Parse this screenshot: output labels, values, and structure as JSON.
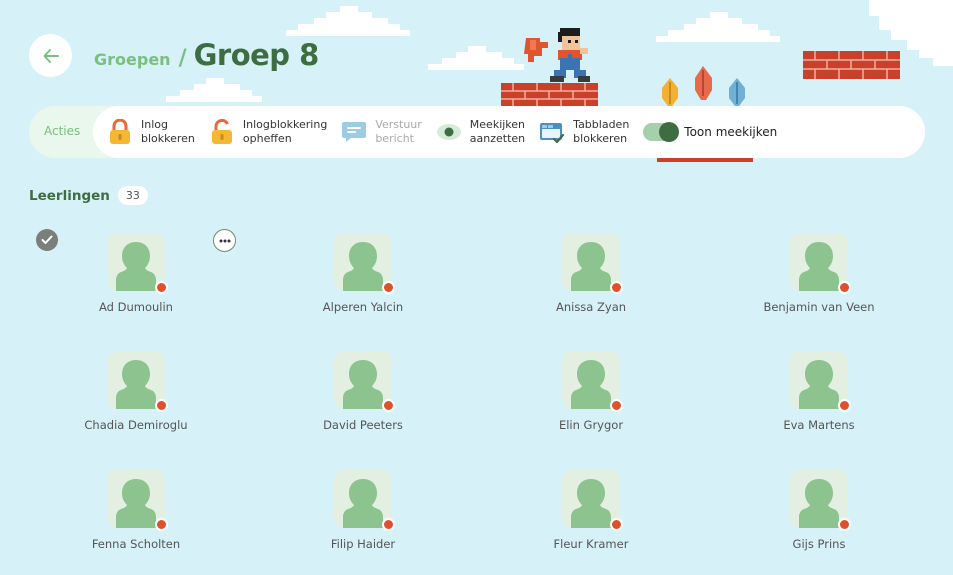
{
  "header": {
    "back_icon": "arrow-left-icon",
    "breadcrumb_parent": "Groepen",
    "breadcrumb_separator": "/",
    "title": "Groep 8"
  },
  "actions": {
    "label": "Acties",
    "items": [
      {
        "label": "Inlog\nblokkeren",
        "icon": "lock-icon",
        "disabled": false
      },
      {
        "label": "Inlogblokkering\nopheffen",
        "icon": "unlock-icon",
        "disabled": false
      },
      {
        "label": "Verstuur\nbericht",
        "icon": "message-icon",
        "disabled": true
      },
      {
        "label": "Meekijken\naanzetten",
        "icon": "eye-icon",
        "disabled": false
      },
      {
        "label": "Tabbladen\nblokkeren",
        "icon": "tabs-block-icon",
        "disabled": false
      }
    ],
    "toggle_label": "Toon meekijken",
    "toggle_on": true
  },
  "students_section": {
    "title": "Leerlingen",
    "count": "33"
  },
  "students": [
    "Ad Dumoulin",
    "Alperen Yalcin",
    "Anissa Zyan",
    "Benjamin van Veen",
    "Chadia Demiroglu",
    "David Peeters",
    "Elin Grygor",
    "Eva Martens",
    "Fenna Scholten",
    "Filip Haider",
    "Fleur Kramer",
    "Gijs Prins"
  ],
  "colors": {
    "background": "#d6f1f8",
    "accent_dark": "#3f6d42",
    "accent_light": "#7bbf80",
    "status_offline": "#e0502c"
  }
}
